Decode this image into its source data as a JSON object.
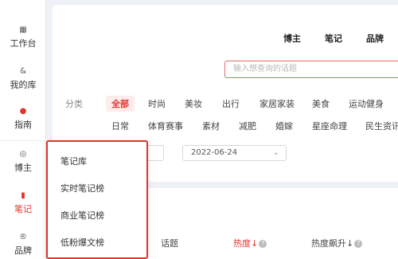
{
  "sidebar": {
    "items": [
      {
        "label": "工作台",
        "icon": "grid-icon"
      },
      {
        "label": "我的库",
        "icon": "user-icon"
      },
      {
        "label": "指南",
        "icon": "pin-icon"
      },
      {
        "label": "博主",
        "icon": "at-icon"
      },
      {
        "label": "笔记",
        "icon": "note-icon"
      },
      {
        "label": "品牌",
        "icon": "brand-icon"
      }
    ]
  },
  "topnav": {
    "blogger": "博主",
    "notes": "笔记",
    "brand": "品牌"
  },
  "search": {
    "placeholder": "输入想查询的话题"
  },
  "filters": {
    "category_label": "分类",
    "row1": [
      "全部",
      "时尚",
      "美妆",
      "出行",
      "家居家装",
      "美食",
      "运动健身"
    ],
    "row2": [
      "日常",
      "体育赛事",
      "素材",
      "减肥",
      "婚嫁",
      "星座命理",
      "民生资讯"
    ]
  },
  "date": {
    "value": "2022-06-24"
  },
  "table": {
    "col_topic": "话题",
    "col_heat": "热度",
    "col_heat_rise": "热度飙升"
  },
  "dropdown": {
    "items": [
      "笔记库",
      "实时笔记榜",
      "商业笔记榜",
      "低粉爆文榜"
    ]
  },
  "colors": {
    "accent": "#e0342c",
    "search_border": "#e26b6b"
  }
}
